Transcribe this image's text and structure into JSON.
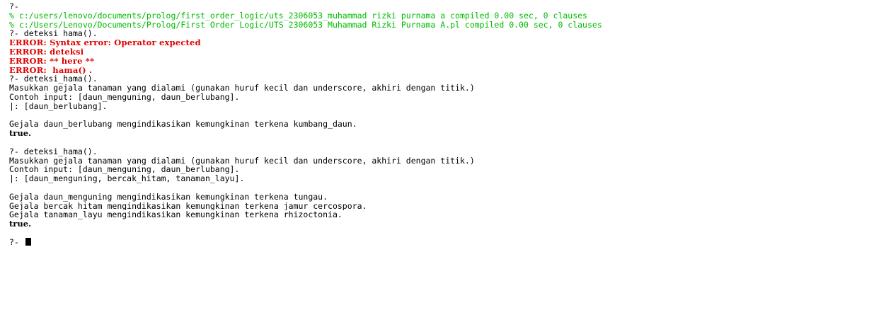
{
  "console": {
    "lines": [
      {
        "style": "normal",
        "text": "?-"
      },
      {
        "style": "green",
        "text": "% c:/users/lenovo/documents/prolog/first_order_logic/uts_2306053_muhammad rizki purnama a compiled 0.00 sec, 0 clauses"
      },
      {
        "style": "green",
        "text": "% c:/Users/Lenovo/Documents/Prolog/First_Order_Logic/UTS_2306053_Muhammad Rizki Purnama A.pl compiled 0.00 sec, 0 clauses"
      },
      {
        "style": "normal",
        "text": "?- deteksi hama()."
      },
      {
        "style": "red",
        "text": "ERROR: Syntax error: Operator expected"
      },
      {
        "style": "red",
        "text": "ERROR: deteksi"
      },
      {
        "style": "red",
        "text": "ERROR: ** here **"
      },
      {
        "style": "red",
        "text": "ERROR:  hama() . "
      },
      {
        "style": "normal",
        "text": "?- deteksi_hama()."
      },
      {
        "style": "normal",
        "text": "Masukkan gejala tanaman yang dialami (gunakan huruf kecil dan underscore, akhiri dengan titik.)"
      },
      {
        "style": "normal",
        "text": "Contoh input: [daun_menguning, daun_berlubang]."
      },
      {
        "style": "normal",
        "text": "|: [daun_berlubang]."
      },
      {
        "style": "blank",
        "text": ""
      },
      {
        "style": "normal",
        "text": "Gejala daun_berlubang mengindikasikan kemungkinan terkena kumbang_daun."
      },
      {
        "style": "bold",
        "text": "true."
      },
      {
        "style": "blank",
        "text": ""
      },
      {
        "style": "normal",
        "text": "?- deteksi_hama()."
      },
      {
        "style": "normal",
        "text": "Masukkan gejala tanaman yang dialami (gunakan huruf kecil dan underscore, akhiri dengan titik.)"
      },
      {
        "style": "normal",
        "text": "Contoh input: [daun_menguning, daun_berlubang]."
      },
      {
        "style": "normal",
        "text": "|: [daun_menguning, bercak_hitam, tanaman_layu]."
      },
      {
        "style": "blank",
        "text": ""
      },
      {
        "style": "normal",
        "text": "Gejala daun_menguning mengindikasikan kemungkinan terkena tungau."
      },
      {
        "style": "normal",
        "text": "Gejala bercak_hitam mengindikasikan kemungkinan terkena jamur_cercospora."
      },
      {
        "style": "normal",
        "text": "Gejala tanaman_layu mengindikasikan kemungkinan terkena rhizoctonia."
      },
      {
        "style": "bold",
        "text": "true."
      },
      {
        "style": "blank",
        "text": ""
      }
    ],
    "prompt": "?- ",
    "colors": {
      "background": "#ffffff",
      "text": "#000000",
      "comment": "#00bb00",
      "error": "#e00000"
    }
  }
}
